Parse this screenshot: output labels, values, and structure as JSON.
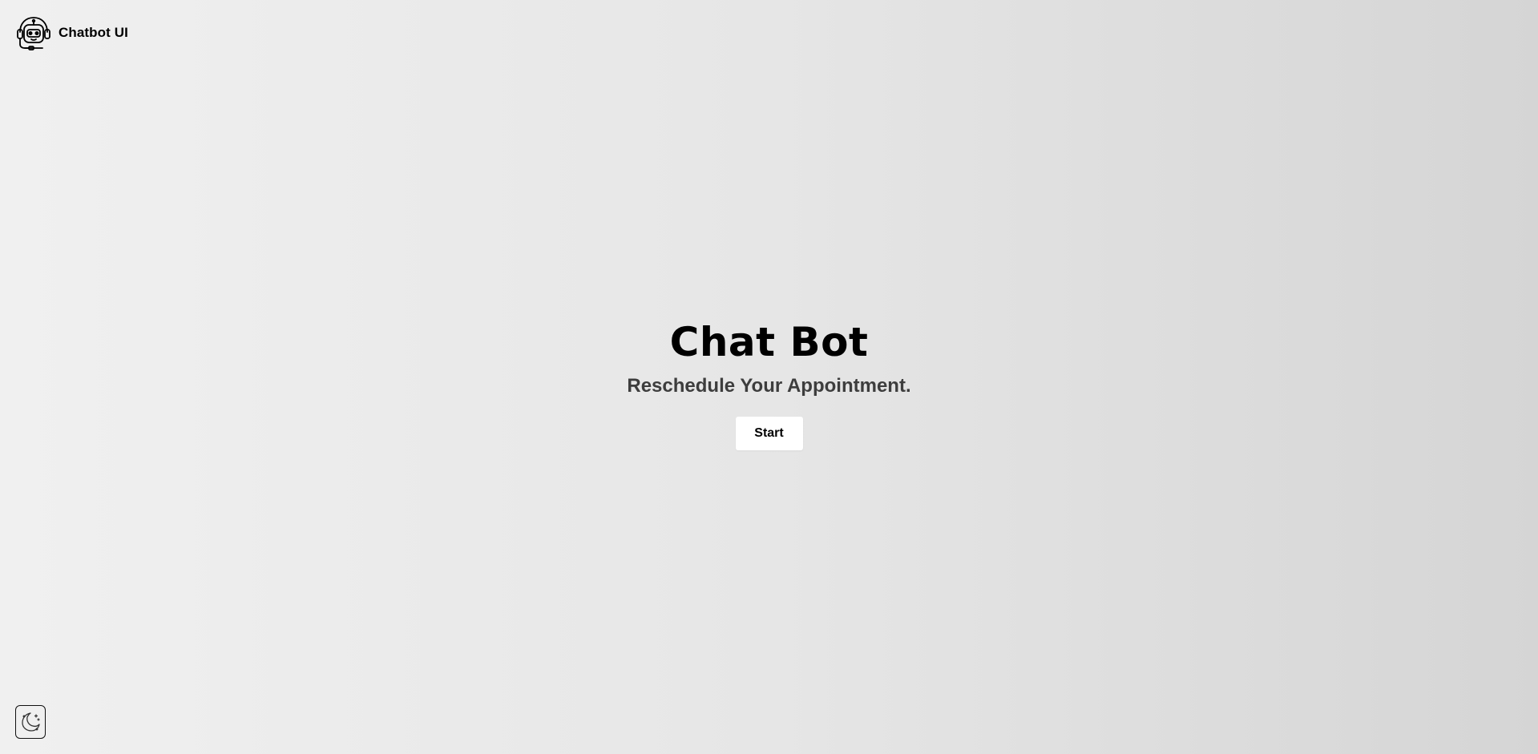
{
  "header": {
    "brand_name": "Chatbot UI",
    "logo_icon": "robot-headset-icon"
  },
  "hero": {
    "title": "Chat Bot",
    "subtitle": "Reschedule Your Appointment.",
    "start_label": "Start"
  },
  "theme_toggle": {
    "icon": "moon-icon"
  },
  "colors": {
    "background_start": "#f0f0f0",
    "background_end": "#d5d5d5",
    "title": "#000000",
    "subtitle": "#3d3d3d",
    "button_bg": "#ffffff"
  }
}
